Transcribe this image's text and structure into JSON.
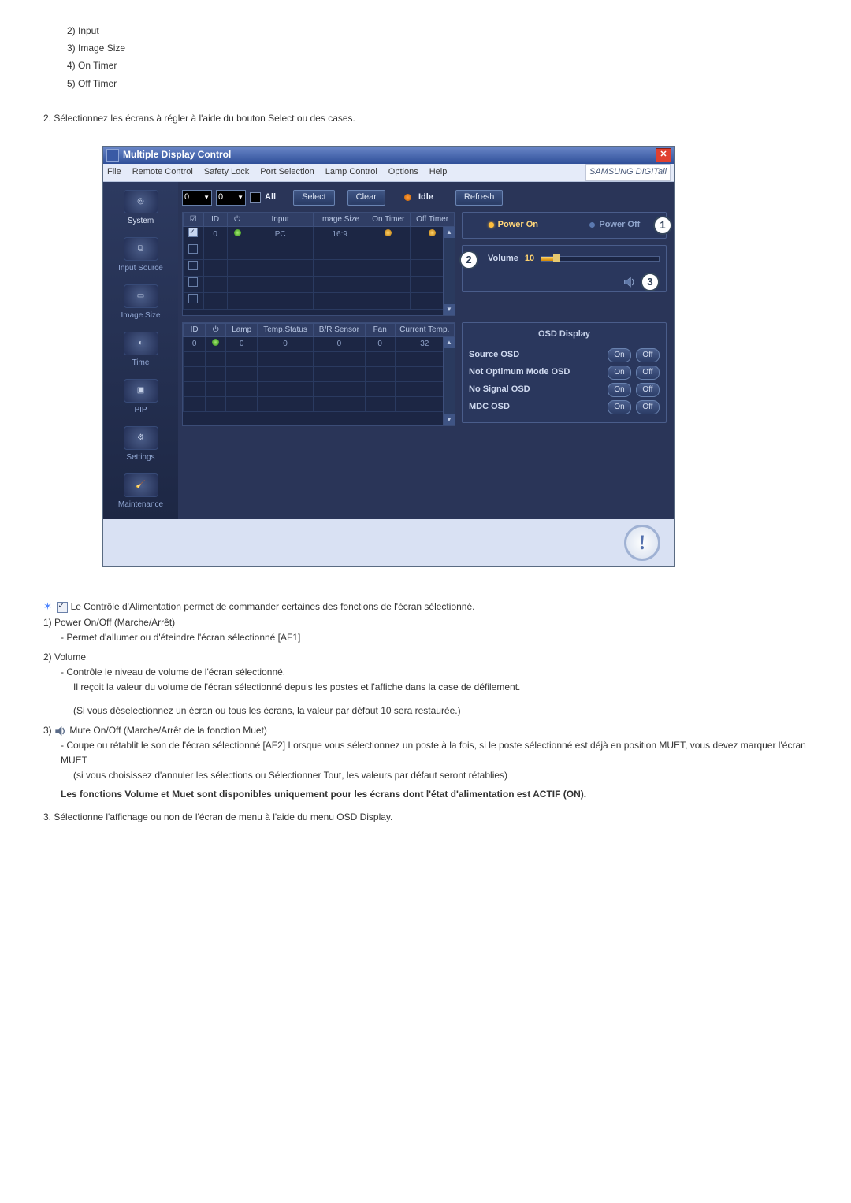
{
  "intro_list": {
    "i2": "2) Input",
    "i3": "3) Image Size",
    "i4": "4) On Timer",
    "i5": "5) Off Timer"
  },
  "step2": "2.  Sélectionnez les écrans à régler à l'aide du bouton Select ou des cases.",
  "app": {
    "title": "Multiple Display Control",
    "menu": {
      "file": "File",
      "remote": "Remote Control",
      "safety": "Safety Lock",
      "port": "Port Selection",
      "lamp": "Lamp Control",
      "options": "Options",
      "help": "Help"
    },
    "brand": "SAMSUNG DIGITall",
    "sidebar": {
      "system": "System",
      "input": "Input Source",
      "image": "Image Size",
      "time": "Time",
      "pip": "PIP",
      "settings": "Settings",
      "maint": "Maintenance"
    },
    "toolbar": {
      "spin1": "0",
      "spin2": "0",
      "all_label": "All",
      "select": "Select",
      "clear": "Clear",
      "idle": "Idle",
      "refresh": "Refresh"
    },
    "grid1": {
      "h_id": "ID",
      "h_input": "Input",
      "h_imgsize": "Image Size",
      "h_ontimer": "On Timer",
      "h_offtimer": "Off Timer",
      "row0": {
        "id": "0",
        "input": "PC",
        "imgsize": "16:9"
      }
    },
    "grid2": {
      "h_id": "ID",
      "h_lamp": "Lamp",
      "h_temp": "Temp.Status",
      "h_br": "B/R Sensor",
      "h_fan": "Fan",
      "h_cur": "Current Temp.",
      "row0": {
        "id": "0",
        "lamp": "0",
        "temp": "0",
        "br": "0",
        "fan": "0",
        "cur": "32"
      }
    },
    "right": {
      "power_on": "Power On",
      "power_off": "Power Off",
      "volume_label": "Volume",
      "volume_value": "10",
      "osd_title": "OSD Display",
      "osd": {
        "source": "Source OSD",
        "notopt": "Not Optimum Mode OSD",
        "nosig": "No Signal OSD",
        "mdc": "MDC OSD"
      },
      "on": "On",
      "off": "Off"
    },
    "callouts": {
      "c1": "1",
      "c2": "2",
      "c3": "3"
    },
    "info": "!"
  },
  "below": {
    "line1": "Le Contrôle d'Alimentation permet de commander certaines des fonctions de l'écran sélectionné.",
    "p1_head": "1)  Power On/Off (Marche/Arrêt)",
    "p1_1": "- Permet d'allumer ou d'éteindre l'écran sélectionné [AF1]",
    "p2_head": "2)  Volume",
    "p2_1": "- Contrôle le niveau de volume de l'écran sélectionné.",
    "p2_2": "Il reçoit la valeur du volume de l'écran sélectionné depuis les postes et l'affiche dans la case de défilement.",
    "p2_3": "(Si vous déselectionnez un écran ou tous les écrans, la valeur par défaut 10 sera restaurée.)",
    "p3_num": "3)",
    "p3_head": "Mute On/Off (Marche/Arrêt de la fonction Muet)",
    "p3_1": "- Coupe ou rétablit le son de l'écran sélectionné [AF2] Lorsque vous sélectionnez un poste à la fois, si le poste sélectionné est déjà en position MUET, vous devez marquer l'écran MUET",
    "p3_2": "(si vous choisissez d'annuler les sélections ou Sélectionner Tout, les valeurs par défaut seront rétablies)",
    "bold_note": "Les fonctions Volume et Muet sont disponibles uniquement pour les écrans dont l'état d'alimentation est ACTIF (ON).",
    "step3": "3.  Sélectionne l'affichage ou non de l'écran de menu à l'aide du menu OSD Display."
  }
}
